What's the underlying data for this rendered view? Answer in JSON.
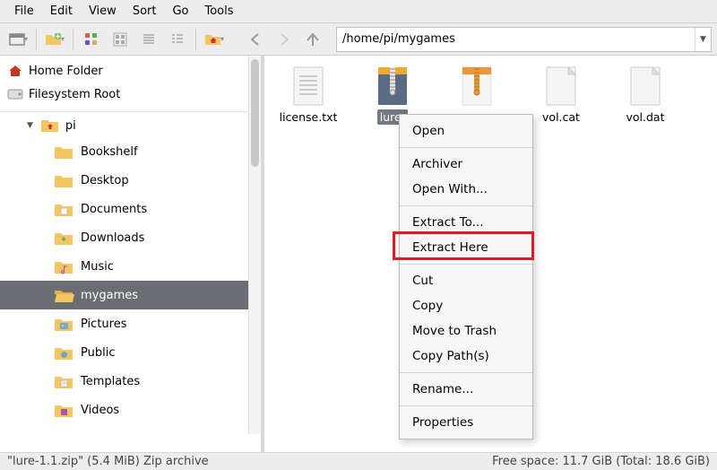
{
  "menu": [
    "File",
    "Edit",
    "View",
    "Sort",
    "Go",
    "Tools"
  ],
  "path": "/home/pi/mygames",
  "places": [
    {
      "name": "Home Folder",
      "icon": "home"
    },
    {
      "name": "Filesystem Root",
      "icon": "drive"
    }
  ],
  "tree_root": "pi",
  "tree_items": [
    {
      "name": "Bookshelf",
      "icon": "folder"
    },
    {
      "name": "Desktop",
      "icon": "folder"
    },
    {
      "name": "Documents",
      "icon": "folder-doc"
    },
    {
      "name": "Downloads",
      "icon": "folder-dl"
    },
    {
      "name": "Music",
      "icon": "folder-music"
    },
    {
      "name": "mygames",
      "icon": "folder-open",
      "selected": true
    },
    {
      "name": "Pictures",
      "icon": "folder-pic"
    },
    {
      "name": "Public",
      "icon": "folder-pub"
    },
    {
      "name": "Templates",
      "icon": "folder-tpl"
    },
    {
      "name": "Videos",
      "icon": "folder-vid"
    }
  ],
  "files": [
    {
      "name": "license.txt",
      "type": "text"
    },
    {
      "name": "lure-1.1.zip",
      "type": "zip-blue",
      "selected": true,
      "display": "lure-"
    },
    {
      "name": "lure-1.1.zip",
      "type": "zip-orange",
      "display": ""
    },
    {
      "name": "vol.cat",
      "type": "blank"
    },
    {
      "name": "vol.dat",
      "type": "blank"
    }
  ],
  "context_menu": [
    {
      "label": "Open"
    },
    {
      "sep": true
    },
    {
      "label": "Archiver"
    },
    {
      "label": "Open With..."
    },
    {
      "sep": true
    },
    {
      "label": "Extract To..."
    },
    {
      "label": "Extract Here",
      "highlight": true
    },
    {
      "sep": true
    },
    {
      "label": "Cut"
    },
    {
      "label": "Copy"
    },
    {
      "label": "Move to Trash"
    },
    {
      "label": "Copy Path(s)"
    },
    {
      "sep": true
    },
    {
      "label": "Rename..."
    },
    {
      "sep": true
    },
    {
      "label": "Properties"
    }
  ],
  "status_left": "\"lure-1.1.zip\" (5.4 MiB) Zip archive",
  "status_right": "Free space: 11.7 GiB (Total: 18.6 GiB)"
}
